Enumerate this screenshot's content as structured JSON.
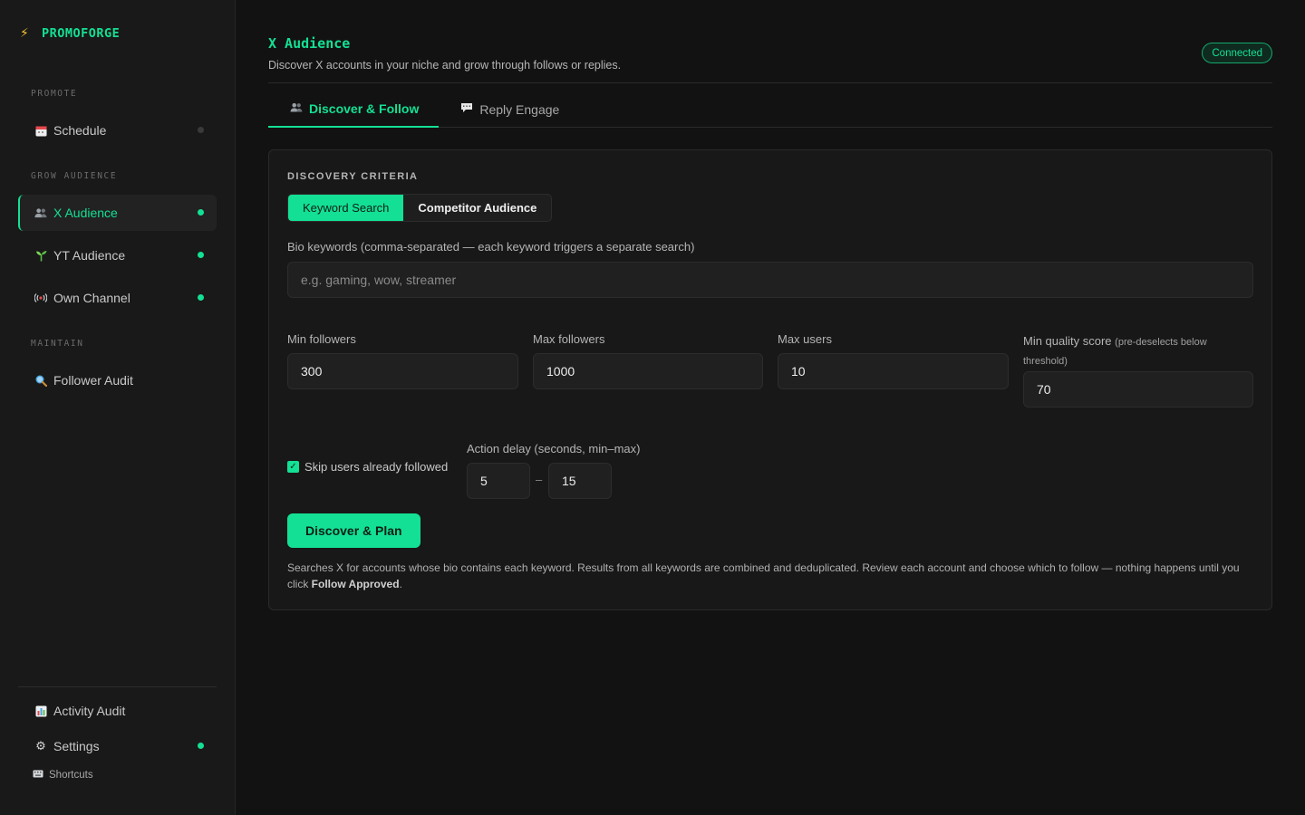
{
  "brand": {
    "name": "PROMOFORGE",
    "icon": "lightning-icon"
  },
  "sidebar": {
    "sections": {
      "promote": "PROMOTE",
      "grow": "GROW AUDIENCE",
      "maintain": "MAINTAIN"
    },
    "items": [
      {
        "label": "Schedule",
        "icon": "calendar-icon",
        "status": "inactive"
      },
      {
        "label": "X Audience",
        "icon": "people-icon",
        "status": "active"
      },
      {
        "label": "YT Audience",
        "icon": "seedling-icon",
        "status": "active"
      },
      {
        "label": "Own Channel",
        "icon": "broadcast-icon",
        "status": "active"
      },
      {
        "label": "Follower Audit",
        "icon": "magnifier-icon"
      },
      {
        "label": "Activity Audit",
        "icon": "bar-chart-icon"
      },
      {
        "label": "Settings",
        "icon": "gear-icon",
        "status": "active"
      }
    ],
    "shortcuts": "Shortcuts"
  },
  "header": {
    "title": "X Audience",
    "subtitle": "Discover X accounts in your niche and grow through follows or replies.",
    "status": "Connected"
  },
  "tabs": [
    {
      "label": "Discover & Follow",
      "icon": "people-icon",
      "active": true
    },
    {
      "label": "Reply Engage",
      "icon": "speech-bubble-icon",
      "active": false
    }
  ],
  "card": {
    "label": "DISCOVERY CRITERIA",
    "modes": [
      {
        "label": "Keyword Search",
        "active": true
      },
      {
        "label": "Competitor Audience",
        "active": false
      }
    ],
    "keywords": {
      "label": "Bio keywords (comma-separated — each keyword triggers a separate search)",
      "placeholder": "e.g. gaming, wow, streamer",
      "value": ""
    },
    "min_followers": {
      "label": "Min followers",
      "value": "300"
    },
    "max_followers": {
      "label": "Max followers",
      "value": "1000"
    },
    "max_users": {
      "label": "Max users",
      "value": "10"
    },
    "min_quality": {
      "label": "Min quality score",
      "note": "(pre-deselects below threshold)",
      "value": "70"
    },
    "skip_followed": {
      "label": "Skip users already followed",
      "checked": true
    },
    "action_delay": {
      "label": "Action delay (seconds, min–max)",
      "min": "5",
      "separator": "–",
      "max": "15"
    },
    "submit": "Discover & Plan",
    "help": {
      "text": "Searches X for accounts whose bio contains each keyword. Results from all keywords are combined and deduplicated. Review each account and choose which to follow — nothing happens until you click ",
      "bold": "Follow Approved",
      "end": "."
    }
  },
  "colors": {
    "accent": "#13e094",
    "background": "#121212",
    "sidebar": "#191919",
    "card": "#181818"
  }
}
